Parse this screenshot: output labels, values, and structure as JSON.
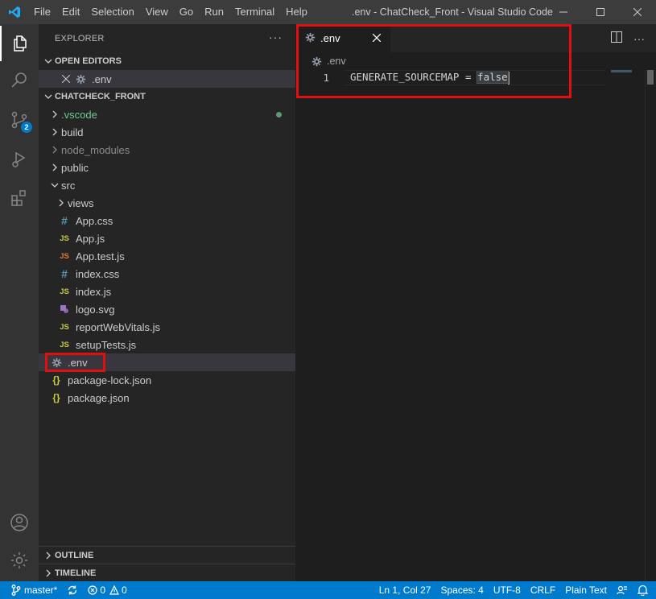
{
  "titlebar": {
    "menu": [
      "File",
      "Edit",
      "Selection",
      "View",
      "Go",
      "Run",
      "Terminal",
      "Help"
    ],
    "window_title": ".env - ChatCheck_Front - Visual Studio Code",
    "logo_icon": "vscode-logo-icon",
    "controls": [
      "minimize-icon",
      "maximize-icon",
      "close-icon"
    ]
  },
  "activitybar": {
    "icons": [
      "files-icon",
      "search-icon",
      "source-control-icon",
      "run-debug-icon",
      "extensions-icon",
      "account-icon",
      "settings-gear-icon"
    ],
    "source_control_badge": "2"
  },
  "sidebar": {
    "header": "EXPLORER",
    "more": "···",
    "open_editors": {
      "title": "OPEN EDITORS",
      "items": [
        {
          "label": ".env",
          "icon": "gear-icon"
        }
      ]
    },
    "project": {
      "title": "CHATCHECK_FRONT",
      "items": [
        {
          "label": ".vscode",
          "type": "folder",
          "expanded": false,
          "color": "#73c991",
          "modified_dot": true
        },
        {
          "label": "build",
          "type": "folder",
          "expanded": false
        },
        {
          "label": "node_modules",
          "type": "folder",
          "expanded": false,
          "dim": true
        },
        {
          "label": "public",
          "type": "folder",
          "expanded": false
        },
        {
          "label": "src",
          "type": "folder",
          "expanded": true
        },
        {
          "label": "views",
          "type": "folder",
          "expanded": false,
          "depth": 1
        },
        {
          "label": "App.css",
          "type": "css",
          "depth": 1
        },
        {
          "label": "App.js",
          "type": "js",
          "depth": 1
        },
        {
          "label": "App.test.js",
          "type": "js-test",
          "depth": 1
        },
        {
          "label": "index.css",
          "type": "css",
          "depth": 1
        },
        {
          "label": "index.js",
          "type": "js",
          "depth": 1
        },
        {
          "label": "logo.svg",
          "type": "svg",
          "depth": 1
        },
        {
          "label": "reportWebVitals.js",
          "type": "js",
          "depth": 1
        },
        {
          "label": "setupTests.js",
          "type": "js",
          "depth": 1
        },
        {
          "label": ".env",
          "type": "env",
          "selected": true
        },
        {
          "label": "package-lock.json",
          "type": "json"
        },
        {
          "label": "package.json",
          "type": "json"
        }
      ]
    },
    "outline": "OUTLINE",
    "timeline": "TIMELINE"
  },
  "editor": {
    "tab": {
      "label": ".env",
      "icon": "gear-icon",
      "close": "×"
    },
    "breadcrumb": ".env",
    "line_number": "1",
    "code_prefix": "GENERATE_SOURCEMAP = ",
    "code_value": "false"
  },
  "statusbar": {
    "branch": "master*",
    "errors": "0",
    "warnings": "0",
    "position": "Ln 1, Col 27",
    "spaces": "Spaces: 4",
    "encoding": "UTF-8",
    "eol": "CRLF",
    "language": "Plain Text"
  },
  "colors": {
    "accent": "#007acc",
    "annotation_red": "#e01010"
  }
}
